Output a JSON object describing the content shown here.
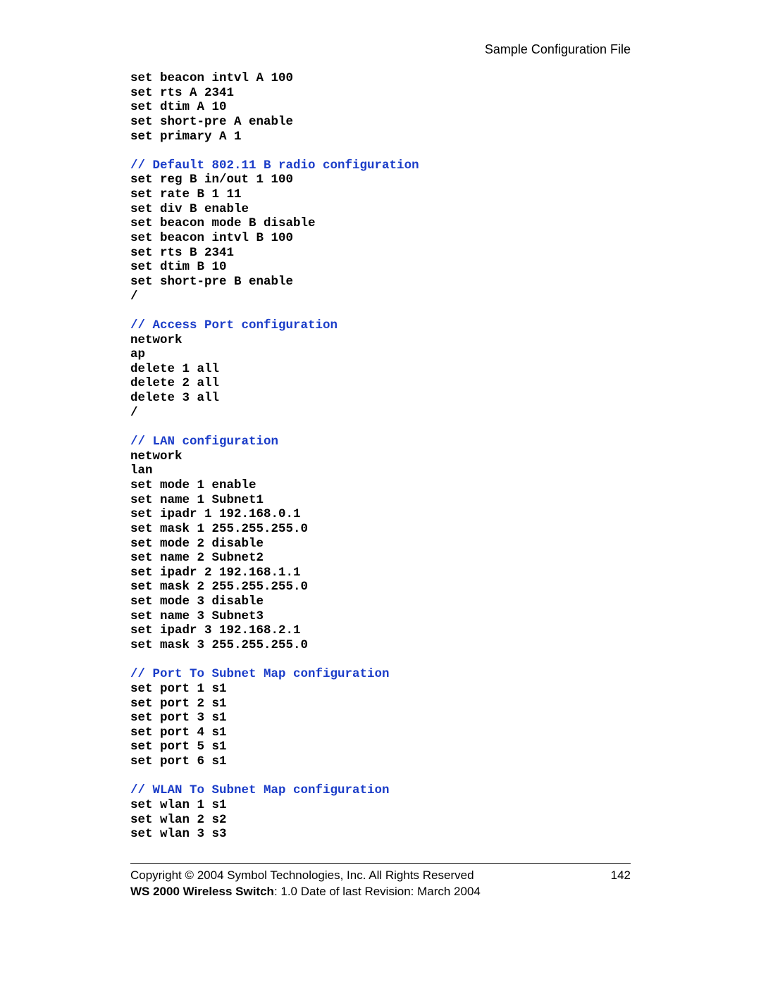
{
  "header": {
    "title": "Sample Configuration File"
  },
  "code": {
    "l01": "set beacon intvl A 100",
    "l02": "set rts A 2341",
    "l03": "set dtim A 10",
    "l04": "set short-pre A enable",
    "l05": "set primary A 1",
    "blank1": "",
    "c1": "// Default 802.11 B radio configuration",
    "l06": "set reg B in/out 1 100",
    "l07": "set rate B 1 11",
    "l08": "set div B enable",
    "l09": "set beacon mode B disable",
    "l10": "set beacon intvl B 100",
    "l11": "set rts B 2341",
    "l12": "set dtim B 10",
    "l13": "set short-pre B enable",
    "l14": "/",
    "blank2": "",
    "c2": "// Access Port configuration",
    "l15": "network",
    "l16": "ap",
    "l17": "delete 1 all",
    "l18": "delete 2 all",
    "l19": "delete 3 all",
    "l20": "/",
    "blank3": "",
    "c3": "// LAN configuration",
    "l21": "network",
    "l22": "lan",
    "l23": "set mode 1 enable",
    "l24": "set name 1 Subnet1",
    "l25": "set ipadr 1 192.168.0.1",
    "l26": "set mask 1 255.255.255.0",
    "l27": "set mode 2 disable",
    "l28": "set name 2 Subnet2",
    "l29": "set ipadr 2 192.168.1.1",
    "l30": "set mask 2 255.255.255.0",
    "l31": "set mode 3 disable",
    "l32": "set name 3 Subnet3",
    "l33": "set ipadr 3 192.168.2.1",
    "l34": "set mask 3 255.255.255.0",
    "blank4": "",
    "c4": "// Port To Subnet Map configuration",
    "l35": "set port 1 s1",
    "l36": "set port 2 s1",
    "l37": "set port 3 s1",
    "l38": "set port 4 s1",
    "l39": "set port 5 s1",
    "l40": "set port 6 s1",
    "blank5": "",
    "c5": "// WLAN To Subnet Map configuration",
    "l41": "set wlan 1 s1",
    "l42": "set wlan 2 s2",
    "l43": "set wlan 3 s3"
  },
  "footer": {
    "line1": "Copyright © 2004 Symbol Technologies, Inc. All Rights Reserved",
    "pagenum": "142",
    "product": "WS 2000 Wireless Switch",
    "rest": ": 1.0  Date of last Revision: March 2004"
  }
}
